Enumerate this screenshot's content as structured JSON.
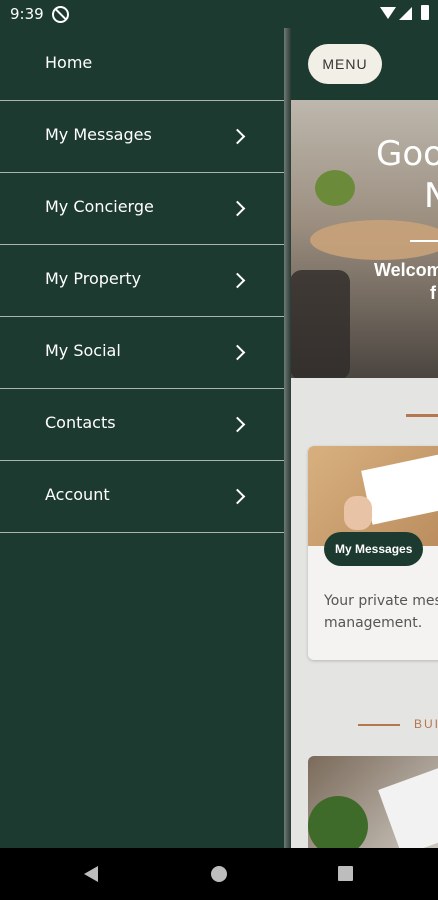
{
  "status": {
    "time": "9:39"
  },
  "main": {
    "menu_label": "MENU",
    "hero_title_line1": "Goo",
    "hero_title_line2": "N",
    "hero_welcome_line1": "Welcom",
    "hero_welcome_line2": "f",
    "card": {
      "badge": "My Messages",
      "text": "Your private mes management."
    },
    "section_label": "BUI"
  },
  "drawer": {
    "items": [
      {
        "label": "Home",
        "chevron": false
      },
      {
        "label": "My Messages",
        "chevron": true
      },
      {
        "label": "My Concierge",
        "chevron": true
      },
      {
        "label": "My Property",
        "chevron": true
      },
      {
        "label": "My Social",
        "chevron": true
      },
      {
        "label": "Contacts",
        "chevron": true
      },
      {
        "label": "Account",
        "chevron": true
      }
    ]
  },
  "icons": {
    "status": [
      "notification-icon",
      "wifi-icon",
      "signal-icon",
      "battery-icon"
    ],
    "nav": [
      "back-icon",
      "home-icon",
      "recents-icon"
    ],
    "drawer_item": "chevron-right-icon"
  },
  "colors": {
    "primary": "#1c3a30",
    "accent": "#b5774f",
    "divider": "#a9b5ae",
    "text_on_primary": "#ffffff"
  }
}
